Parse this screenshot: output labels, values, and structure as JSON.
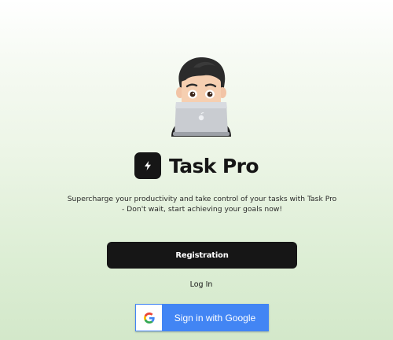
{
  "brand": {
    "name": "Task Pro",
    "logo_icon": "lightning-bolt-icon",
    "logo_color": "#161616"
  },
  "hero": {
    "avatar_icon": "memoji-laptop-avatar",
    "tagline": "Supercharge your productivity and take control of your tasks with Task Pro - Don't wait, start achieving your goals now!"
  },
  "actions": {
    "register_label": "Registration",
    "login_label": "Log In",
    "google_label": "Sign in with Google",
    "google_icon": "google-g-icon",
    "google_color": "#4285f4"
  },
  "theme": {
    "background_top": "#ffffff",
    "background_bottom": "#d3e8ca",
    "primary": "#161616"
  }
}
